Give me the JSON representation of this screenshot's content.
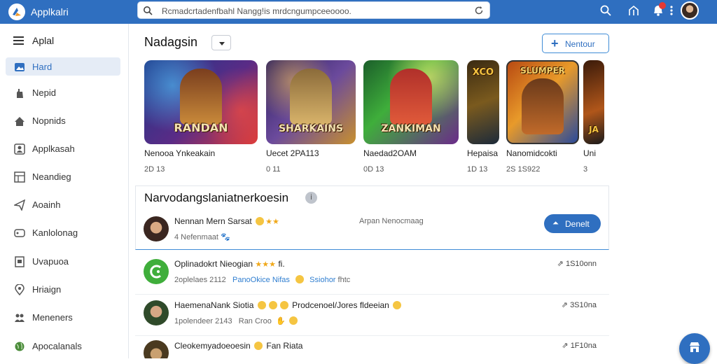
{
  "app": {
    "title": "Applkalri",
    "accent": "#2f6fc0"
  },
  "search": {
    "value": "Rcmadcrtadenfbahl Nangg!is mrdcngumpceeoooo."
  },
  "sidebar": {
    "menu_label": "Aplal",
    "items": [
      {
        "label": "Hard",
        "icon": "photo-icon",
        "active": true
      },
      {
        "label": "Nepid",
        "icon": "hand-icon"
      },
      {
        "label": "Nopnids",
        "icon": "home-icon"
      },
      {
        "label": "Applkasah",
        "icon": "person-icon"
      },
      {
        "label": "Neandieg",
        "icon": "grid-icon"
      },
      {
        "label": "Aoainh",
        "icon": "send-icon"
      },
      {
        "label": "Kanlolonag",
        "icon": "card-icon"
      },
      {
        "label": "Uvapuoa",
        "icon": "document-icon"
      },
      {
        "label": "Hriaign",
        "icon": "location-icon"
      },
      {
        "label": "Meneners",
        "icon": "group-icon"
      },
      {
        "label": "Apocalanals",
        "icon": "globe-icon"
      }
    ]
  },
  "main": {
    "section_title": "Nadagsin",
    "new_button": "Nentour",
    "cards": [
      {
        "name": "Nenooa Ynkeakain",
        "meta": "2D 13",
        "logo": "RANDAN",
        "theme": "blue-red"
      },
      {
        "name": "Uecet 2PA113",
        "meta": "0 11",
        "logo": "SHARKAINS",
        "theme": "purple-gold"
      },
      {
        "name": "Naedad2OAM",
        "meta": "0D 13",
        "logo": "ZANKIMAN",
        "theme": "green-red"
      },
      {
        "name": "Hepaisa",
        "meta": "1D 13",
        "logo": "XCO",
        "theme": "dark-gold"
      },
      {
        "name": "Nanomidcokti",
        "meta": "2S 1S922",
        "logo": "SLUMPER",
        "theme": "orange-blue"
      },
      {
        "name": "Uni",
        "meta": "3",
        "logo": "JA",
        "theme": "dark-orange"
      }
    ]
  },
  "discussion": {
    "title": "Narvodangslaniatnerkoesin",
    "featured": {
      "name": "Nennan Mern Sarsat",
      "sub": "4 Nefenmaat",
      "mid": "Arpan Nenocmaag",
      "button": "Denelt"
    },
    "rows": [
      {
        "name": "Oplinadokrt Nieogian",
        "sub": "2oplelaes 2112",
        "link1": "PanoOkice Nifas",
        "link2": "Ssiohor",
        "extra": "fhtc",
        "time": "1S10onn"
      },
      {
        "name": "HaemenaNank Siotia",
        "name_extra": "Prodcenoel/Jores fldeeian",
        "sub": "1polendeer 2143",
        "mid": "Ran Croo",
        "time": "3S10na"
      },
      {
        "name": "Cleokemyadoeoesin",
        "name_extra": "Fan Riata",
        "sub": "",
        "time": "1F10na"
      }
    ]
  }
}
